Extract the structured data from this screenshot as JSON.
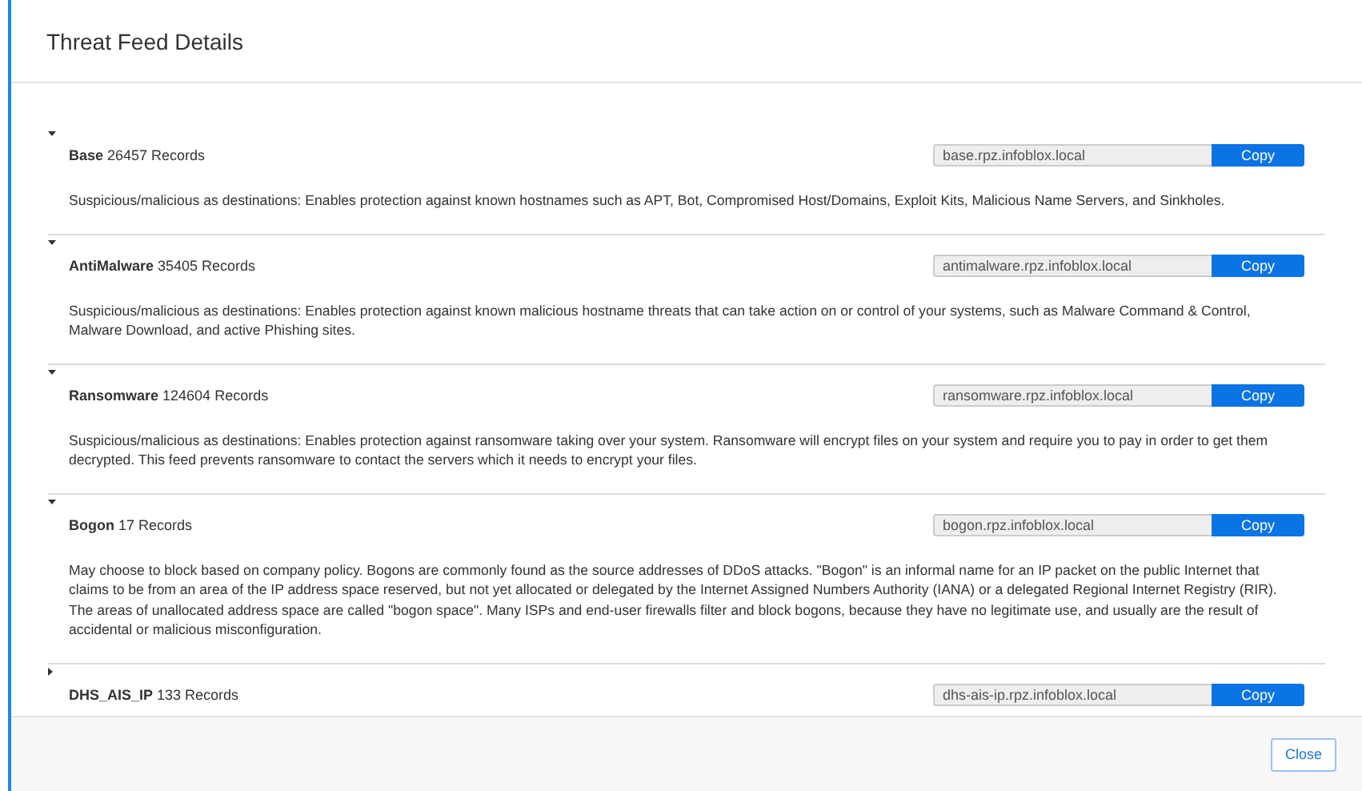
{
  "dialog": {
    "title": "Threat Feed Details"
  },
  "feeds": [
    {
      "name": "Base",
      "records": "26457 Records",
      "expanded": true,
      "address": "base.rpz.infoblox.local",
      "copy_label": "Copy",
      "description": "Suspicious/malicious as destinations: Enables protection against known hostnames such as APT, Bot, Compromised Host/Domains, Exploit Kits, Malicious Name Servers, and Sinkholes."
    },
    {
      "name": "AntiMalware",
      "records": "35405 Records",
      "expanded": true,
      "address": "antimalware.rpz.infoblox.local",
      "copy_label": "Copy",
      "description": "Suspicious/malicious as destinations: Enables protection against known malicious hostname threats that can take action on or control of your systems, such as Malware Command & Control, Malware Download, and active Phishing sites."
    },
    {
      "name": "Ransomware",
      "records": "124604 Records",
      "expanded": true,
      "address": "ransomware.rpz.infoblox.local",
      "copy_label": "Copy",
      "description": "Suspicious/malicious as destinations: Enables protection against ransomware taking over your system. Ransomware will encrypt files on your system and require you to pay in order to get them decrypted. This feed prevents ransomware to contact the servers which it needs to encrypt your files."
    },
    {
      "name": "Bogon",
      "records": "17 Records",
      "expanded": true,
      "address": "bogon.rpz.infoblox.local",
      "copy_label": "Copy",
      "description": "May choose to block based on company policy. Bogons are commonly found as the source addresses of DDoS attacks. \"Bogon\" is an informal name for an IP packet on the public Internet that claims to be from an area of the IP address space reserved, but not yet allocated or delegated by the Internet Assigned Numbers Authority (IANA) or a delegated Regional Internet Registry (RIR). The areas of unallocated address space are called \"bogon space\". Many ISPs and end-user firewalls filter and block bogons, because they have no legitimate use, and usually are the result of accidental or malicious misconfiguration."
    },
    {
      "name": "DHS_AIS_IP",
      "records": "133 Records",
      "expanded": false,
      "address": "dhs-ais-ip.rpz.infoblox.local",
      "copy_label": "Copy"
    }
  ],
  "footer": {
    "close_label": "Close"
  }
}
